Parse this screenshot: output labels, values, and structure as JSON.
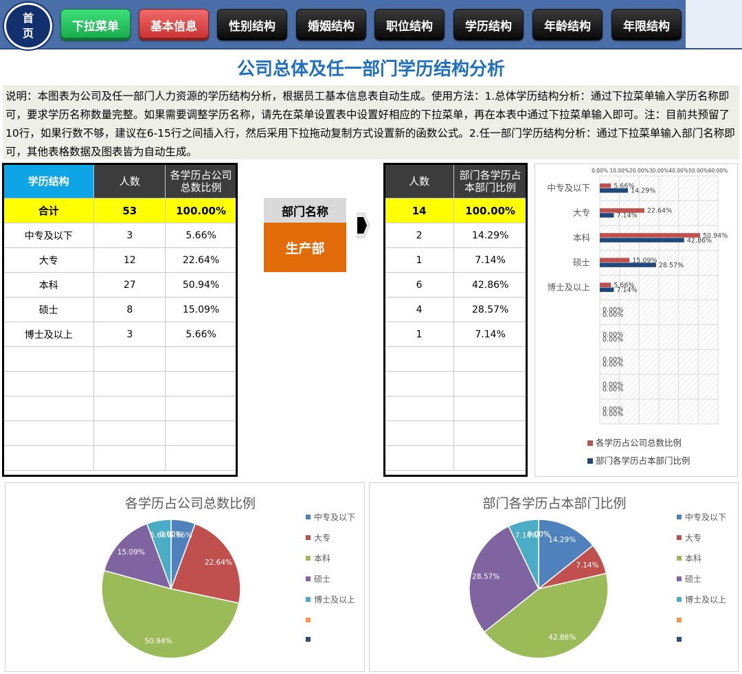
{
  "nav": {
    "home_line1": "首",
    "home_line2": "页",
    "buttons": [
      "下拉菜单",
      "基本信息",
      "性别结构",
      "婚姻结构",
      "职位结构",
      "学历结构",
      "年龄结构",
      "年限结构"
    ]
  },
  "page_title": "公司总体及任一部门学历结构分析",
  "description": "说明：本图表为公司及任一部门人力资源的学历结构分析，根据员工基本信息表自动生成。使用方法：1.总体学历结构分析：通过下拉菜单输入学历名称即可，要求学历名称数量完整。如果需要调整学历名称，请先在菜单设置表中设置好相应的下拉菜单，再在本表中通过下拉菜单输入即可。注：目前共预留了10行，如果行数不够，建议在6-15行之间插入行，然后采用下拉拖动复制方式设置新的函数公式。2.任一部门学历结构分析：通过下拉菜单输入部门名称即可，其他表格数据及图表皆为自动生成。",
  "company_table": {
    "headers": [
      "学历结构",
      "人数",
      "各学历占公司总数比例"
    ],
    "total": {
      "label": "合计",
      "count": "53",
      "ratio": "100.00%"
    },
    "rows": [
      {
        "label": "中专及以下",
        "count": "3",
        "ratio": "5.66%"
      },
      {
        "label": "大专",
        "count": "12",
        "ratio": "22.64%"
      },
      {
        "label": "本科",
        "count": "27",
        "ratio": "50.94%"
      },
      {
        "label": "硕士",
        "count": "8",
        "ratio": "15.09%"
      },
      {
        "label": "博士及以上",
        "count": "3",
        "ratio": "5.66%"
      },
      {
        "label": "",
        "count": "",
        "ratio": ""
      },
      {
        "label": "",
        "count": "",
        "ratio": ""
      },
      {
        "label": "",
        "count": "",
        "ratio": ""
      },
      {
        "label": "",
        "count": "",
        "ratio": ""
      },
      {
        "label": "",
        "count": "",
        "ratio": ""
      }
    ]
  },
  "department": {
    "label": "部门名称",
    "value": "生产部"
  },
  "dept_table": {
    "headers": [
      "人数",
      "部门各学历占本部门比例"
    ],
    "total": {
      "count": "14",
      "ratio": "100.00%"
    },
    "rows": [
      {
        "count": "2",
        "ratio": "14.29%"
      },
      {
        "count": "1",
        "ratio": "7.14%"
      },
      {
        "count": "6",
        "ratio": "42.86%"
      },
      {
        "count": "4",
        "ratio": "28.57%"
      },
      {
        "count": "1",
        "ratio": "7.14%"
      },
      {
        "count": "",
        "ratio": ""
      },
      {
        "count": "",
        "ratio": ""
      },
      {
        "count": "",
        "ratio": ""
      },
      {
        "count": "",
        "ratio": ""
      },
      {
        "count": "",
        "ratio": ""
      }
    ]
  },
  "colors": {
    "company_series": "#c0504d",
    "dept_series": "#1f497d",
    "pie": [
      "#4f81bd",
      "#c0504d",
      "#9bbb59",
      "#8064a2",
      "#4bacc6",
      "#f79646",
      "#2c4d75"
    ]
  },
  "chart_data": [
    {
      "type": "bar",
      "orientation": "horizontal",
      "categories": [
        "中专及以下",
        "大专",
        "本科",
        "硕士",
        "博士及以上",
        "",
        "",
        "",
        "",
        ""
      ],
      "series": [
        {
          "name": "各学历占公司总数比例",
          "values": [
            5.66,
            22.64,
            50.94,
            15.09,
            5.66,
            0,
            0,
            0,
            0,
            0
          ]
        },
        {
          "name": "部门各学历占本部门比例",
          "values": [
            14.29,
            7.14,
            42.86,
            28.57,
            7.14,
            0,
            0,
            0,
            0,
            0
          ]
        }
      ],
      "value_labels": [
        [
          "5.66%",
          "22.64%",
          "50.94%",
          "15.09%",
          "5.66%",
          "0.00%",
          "0.00%",
          "0.00%",
          "0.00%",
          "0.00%"
        ],
        [
          "14.29%",
          "7.14%",
          "42.86%",
          "28.57%",
          "7.14%",
          "0.00%",
          "0.00%",
          "0.00%",
          "0.00%",
          "0.00%"
        ]
      ],
      "xlim": [
        0,
        60
      ],
      "x_ticks": [
        "0.00%",
        "10.00%",
        "20.00%",
        "30.00%",
        "40.00%",
        "50.00%",
        "60.00%"
      ],
      "x_axis_position": "top",
      "grid": true,
      "legend": "bottom"
    },
    {
      "type": "pie",
      "title": "各学历占公司总数比例",
      "labels": [
        "中专及以下",
        "大专",
        "本科",
        "硕士",
        "博士及以上",
        "",
        ""
      ],
      "values": [
        5.66,
        22.64,
        50.94,
        15.09,
        5.66,
        0,
        0
      ],
      "value_labels": [
        "5.66%",
        "22.64%",
        "50.94%",
        "15.09%",
        "5.66%",
        "0.00%",
        "0.00%"
      ],
      "legend": "right"
    },
    {
      "type": "pie",
      "title": "部门各学历占本部门比例",
      "labels": [
        "中专及以下",
        "大专",
        "本科",
        "硕士",
        "博士及以上",
        "",
        ""
      ],
      "values": [
        14.29,
        7.14,
        42.86,
        28.57,
        7.14,
        0,
        0
      ],
      "value_labels": [
        "14.29%",
        "7.14%",
        "42.86%",
        "28.57%",
        "7.14%",
        "0.00%",
        "0.00%"
      ],
      "legend": "right"
    }
  ]
}
